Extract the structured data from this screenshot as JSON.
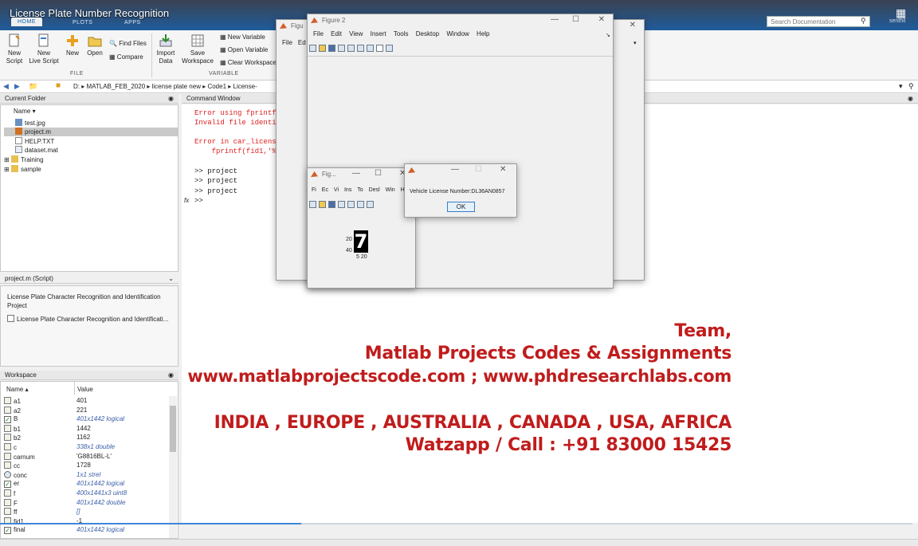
{
  "video_title": "License Plate Number Recognition",
  "tabs": [
    "HOME",
    "PLOTS",
    "APPS"
  ],
  "search_placeholder": "Search Documentation",
  "user_name": "senthil",
  "ribbon": {
    "new_script": "New\nScript",
    "new_live_script": "New\nLive Script",
    "new": "New",
    "open": "Open",
    "find_files": "Find Files",
    "compare": "Compare",
    "import_data": "Import\nData",
    "save_workspace": "Save\nWorkspace",
    "new_variable": "New Variable",
    "open_variable": "Open Variable",
    "clear_workspace": "Clear Workspace",
    "section_file": "FILE",
    "section_variable": "VARIABLE"
  },
  "breadcrumb": [
    "D:",
    "MATLAB_FEB_2020",
    "license plate new",
    "Code1",
    "License-"
  ],
  "current_folder": {
    "title": "Current Folder",
    "col_name": "Name",
    "files": [
      "test.jpg",
      "project.m",
      "HELP.TXT",
      "dataset.mat",
      "Training",
      "sample"
    ]
  },
  "details": {
    "title": "project.m  (Script)",
    "description": "License Plate Character Recognition and Identification Project",
    "item": "License Plate Character Recognition and Identificati..."
  },
  "workspace": {
    "title": "Workspace",
    "col_name": "Name",
    "col_value": "Value",
    "vars": [
      {
        "name": "a1",
        "value": "401"
      },
      {
        "name": "a2",
        "value": "221"
      },
      {
        "name": "B",
        "value": "401x1442 logical"
      },
      {
        "name": "b1",
        "value": "1442"
      },
      {
        "name": "b2",
        "value": "1162"
      },
      {
        "name": "c",
        "value": "338x1 double"
      },
      {
        "name": "carnum",
        "value": "'G8816BL-L'"
      },
      {
        "name": "cc",
        "value": "1728"
      },
      {
        "name": "conc",
        "value": "1x1 strel"
      },
      {
        "name": "er",
        "value": "401x1442 logical"
      },
      {
        "name": "f",
        "value": "400x1441x3 uint8"
      },
      {
        "name": "F",
        "value": "401x1442 double"
      },
      {
        "name": "ff",
        "value": "[]"
      },
      {
        "name": "fid1",
        "value": "-1"
      },
      {
        "name": "final",
        "value": "401x1442 logical"
      }
    ]
  },
  "command_window": {
    "title": "Command Window",
    "lines": [
      "Error using fprintf",
      "Invalid file identi",
      "",
      "Error in car_licens",
      "    fprintf(fid1,'%",
      "",
      ">> project",
      ">> project",
      ">> project",
      ">>"
    ],
    "prompt": "fx"
  },
  "figure1": {
    "title": "Figu",
    "menu": [
      "File",
      "Ed"
    ]
  },
  "figure2": {
    "title": "Figure 2",
    "menu": [
      "File",
      "Edit",
      "View",
      "Insert",
      "Tools",
      "Desktop",
      "Window",
      "Help"
    ]
  },
  "figure_small": {
    "title": "Fig...",
    "menu": [
      "Fi",
      "Ec",
      "Vi",
      "Ins",
      "To",
      "Desl",
      "Win",
      "He"
    ],
    "glyph": "7",
    "ytick1": "20",
    "ytick2": "40",
    "xticks": "5 20"
  },
  "dialog": {
    "message": "Vehicle License Number:DL36AN0857",
    "ok": "OK"
  },
  "overlay": {
    "line1": "Team,",
    "line2": "Matlab Projects Codes & Assignments",
    "line3": "www.matlabprojectscode.com ; www.phdresearchlabs.com",
    "line4": "INDIA , EUROPE , AUSTRALIA , CANADA , USA, AFRICA",
    "line5": "Watzapp / Call : +91 83000 15425"
  },
  "colors": {
    "overlay_red": "#c01c1c",
    "error_red": "#e02020",
    "matlab_blue": "#0a5ea8"
  },
  "progress_fraction": 0.33
}
